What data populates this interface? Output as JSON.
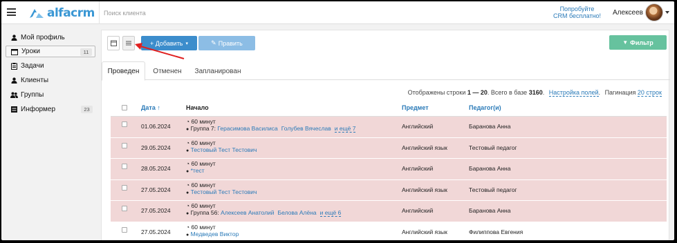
{
  "header": {
    "logo_text": "alfacrm",
    "search_placeholder": "Поиск клиента",
    "try_line1": "Попробуйте",
    "try_line2": "CRM бесплатно!",
    "username": "Алексеев"
  },
  "sidebar": {
    "items": [
      {
        "label": "Мой профиль",
        "icon": "user-icon",
        "badge": ""
      },
      {
        "label": "Уроки",
        "icon": "calendar-icon",
        "badge": "11"
      },
      {
        "label": "Задачи",
        "icon": "clipboard-icon",
        "badge": ""
      },
      {
        "label": "Клиенты",
        "icon": "user-icon",
        "badge": ""
      },
      {
        "label": "Группы",
        "icon": "users-icon",
        "badge": ""
      },
      {
        "label": "Информер",
        "icon": "list-icon",
        "badge": "23"
      }
    ]
  },
  "toolbar": {
    "add_label": "+ Добавить",
    "edit_label": "Править",
    "filter_label": "Фильтр"
  },
  "tabs": [
    "Проведен",
    "Отменен",
    "Запланирован"
  ],
  "stats": {
    "prefix": "Отображены строки ",
    "range": "1 — 20",
    "middle": ". Всего в базе ",
    "total": "3160",
    "suffix": ".",
    "settings_link": "Настройка полей",
    "pagination_label": "Пагинация",
    "pagination_link": "20 строк"
  },
  "table": {
    "headers": {
      "date": "Дата ↑",
      "start": "Начало",
      "subject": "Предмет",
      "teacher": "Педагог(и)"
    },
    "rows": [
      {
        "date": "01.06.2024",
        "duration": "60 минут",
        "prefix": "Группа 7: ",
        "links": [
          "Герасимова Василиса",
          "Голубев Вячеслав"
        ],
        "more": "и ещё 7",
        "subject": "Английский",
        "teacher": "Баранова Анна",
        "highlight": true
      },
      {
        "date": "29.05.2024",
        "duration": "60 минут",
        "prefix": "",
        "links": [
          "Тестовый Тест Тестович"
        ],
        "more": "",
        "subject": "Английский язык",
        "teacher": "Тестовый педагог",
        "highlight": true
      },
      {
        "date": "28.05.2024",
        "duration": "60 минут",
        "prefix": "",
        "links": [
          "*тест"
        ],
        "more": "",
        "subject": "Английский",
        "teacher": "Баранова Анна",
        "highlight": true
      },
      {
        "date": "27.05.2024",
        "duration": "60 минут",
        "prefix": "",
        "links": [
          "Тестовый Тест Тестович"
        ],
        "more": "",
        "subject": "Английский язык",
        "teacher": "Тестовый педагог",
        "highlight": true
      },
      {
        "date": "27.05.2024",
        "duration": "60 минут",
        "prefix": "Группа 56: ",
        "links": [
          "Алексеев Анатолий",
          "Белова Алёна"
        ],
        "more": "и ещё 6",
        "subject": "Английский",
        "teacher": "Баранова Анна",
        "highlight": true
      },
      {
        "date": "27.05.2024",
        "duration": "60 минут",
        "prefix": "",
        "links": [
          "Медведев Виктор"
        ],
        "more": "",
        "subject": "Английский язык",
        "teacher": "Филиппова Евгения",
        "highlight": false
      }
    ]
  },
  "colors": {
    "accent": "#3c8dcc",
    "filter": "#66c29e",
    "row_highlight": "#f1d7d7",
    "annotation_arrow": "#e02020"
  }
}
